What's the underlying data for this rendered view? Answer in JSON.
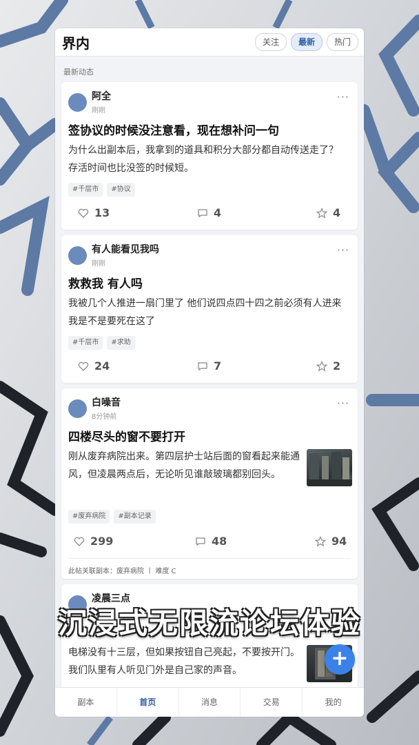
{
  "app": {
    "title": "界内",
    "tabs": [
      "关注",
      "最新",
      "热门"
    ],
    "active_tab": "最新",
    "section_label": "最新动态"
  },
  "posts": [
    {
      "author": "阿全",
      "time": "刚刚",
      "title": "签协议的时候没注意看，现在想补问一句",
      "body": "为什么出副本后，我拿到的道具和积分大部分都自动传送走了？存活时间也比没签的时候短。",
      "tags": [
        "#千层市",
        "#协议"
      ],
      "likes": "13",
      "comments": "4",
      "stars": "4"
    },
    {
      "author": "有人能看见我吗",
      "time": "刚刚",
      "title": "救救我 有人吗",
      "body": "我被几个人推进一扇门里了 他们说四点四十四之前必须有人进来 我是不是要死在这了",
      "tags": [
        "#千层市",
        "#求助"
      ],
      "likes": "24",
      "comments": "7",
      "stars": "2"
    },
    {
      "author": "白噪音",
      "time": "8分钟前",
      "title": "四楼尽头的窗不要打开",
      "body": "刚从废弃病院出来。第四层护士站后面的窗看起来能通风，但凌晨两点后，无论听见谁敲玻璃都别回头。",
      "tags": [
        "#废弃病院",
        "#副本记录"
      ],
      "likes": "299",
      "comments": "48",
      "stars": "94",
      "related": "此帖关联副本：废弃病院 丨 难度 C"
    },
    {
      "author": "凌晨三点",
      "body": "电梯没有十三层，但如果按钮自己亮起，不要按开门。我们队里有人听见门外是自己家的声音。"
    }
  ],
  "fab_label": "+",
  "nav": [
    "副本",
    "首页",
    "消息",
    "交易",
    "我的"
  ],
  "nav_active": "首页",
  "caption": "沉浸式无限流论坛体验",
  "colors": {
    "accent": "#2f5ea8",
    "fab": "#3b82e8",
    "avatar": "#6a8bbb"
  },
  "icons": {
    "like": "heart-icon",
    "comment": "comment-icon",
    "star": "star-icon",
    "more": "more-icon"
  }
}
